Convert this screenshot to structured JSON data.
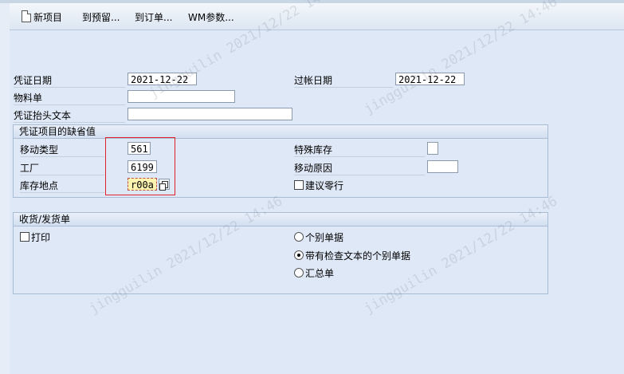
{
  "toolbar": {
    "new_item": "新项目",
    "to_reservation": "到预留...",
    "to_order": "到订单...",
    "wm_params": "WM参数..."
  },
  "header": {
    "doc_date_label": "凭证日期",
    "doc_date_value": "2021-12-22",
    "post_date_label": "过帐日期",
    "post_date_value": "2021-12-22",
    "bill_of_lading_label": "物料单",
    "bill_of_lading_value": "",
    "header_text_label": "凭证抬头文本",
    "header_text_value": ""
  },
  "defaults": {
    "title": "凭证项目的缺省值",
    "movement_type_label": "移动类型",
    "movement_type_value": "561",
    "plant_label": "工厂",
    "plant_value": "6199",
    "storage_location_label": "库存地点",
    "storage_location_value": "r00a",
    "special_stock_label": "特殊库存",
    "special_stock_value": "",
    "reason_label": "移动原因",
    "reason_value": "",
    "suggest_zero_label": "建议零行",
    "suggest_zero_checked": false
  },
  "receipt": {
    "title": "收货/发货单",
    "print_label": "打印",
    "print_checked": false,
    "options": [
      {
        "label": "个别单据",
        "selected": false
      },
      {
        "label": "带有检查文本的个别单据",
        "selected": true
      },
      {
        "label": "汇总单",
        "selected": false
      }
    ]
  },
  "watermark": "jingguilin 2021/12/22 14:46",
  "colors": {
    "highlight_border": "#e0202a",
    "focused_input": "#fff3b0"
  }
}
